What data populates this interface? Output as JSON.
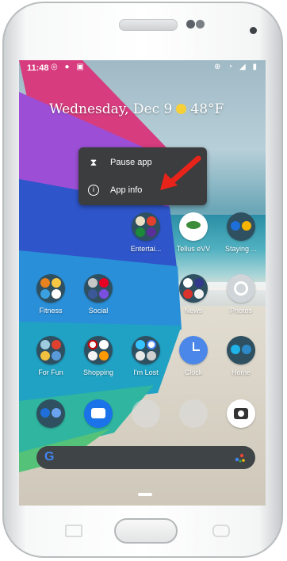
{
  "status_bar": {
    "time": "11:48",
    "left_icons": "◎ ● ▣",
    "right_icons": "⊕ ◔ ◢ ▮"
  },
  "date_widget": {
    "date": "Wednesday, Dec 9",
    "temperature": "48°F",
    "weather_icon": "sun-icon"
  },
  "context_menu": {
    "items": [
      {
        "label": "Pause app",
        "icon": "hourglass-icon"
      },
      {
        "label": "App info",
        "icon": "info-icon"
      }
    ]
  },
  "apps": {
    "row1": [
      {
        "label": "Entertai..."
      },
      {
        "label": "Tellus eVV"
      },
      {
        "label": "Staying ..."
      }
    ],
    "row2": [
      {
        "label": "Fitness"
      },
      {
        "label": "Social"
      },
      {
        "label": "News"
      },
      {
        "label": "Photos"
      }
    ],
    "row3": [
      {
        "label": "For Fun"
      },
      {
        "label": "Shopping"
      },
      {
        "label": "I'm Lost"
      },
      {
        "label": "Clock"
      },
      {
        "label": "Home"
      }
    ],
    "dock": [
      "phone-icon",
      "messages-icon",
      "gmail-icon",
      "chrome-icon",
      "camera-icon"
    ]
  },
  "search_bar": {
    "logo": "G"
  },
  "colors": {
    "menu_bg": "#3b3d3f",
    "arrow": "#e8231a",
    "search_bg": "#3f4447"
  }
}
